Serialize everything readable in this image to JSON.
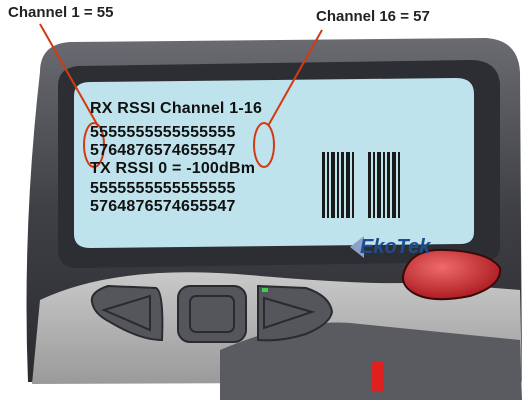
{
  "callouts": {
    "left": "Channel 1 = 55",
    "right": "Channel 16 = 57"
  },
  "lcd": {
    "lines": [
      "RX RSSI Channel 1-16",
      "5555555555555555",
      "5764876574655547",
      "TX RSSI 0 = -100dBm",
      "5555555555555555",
      "5764876574655547"
    ]
  },
  "logo": {
    "text": "EkoTek"
  },
  "colors": {
    "lcd_background": "#bfe3ec",
    "device_body": "#4a4b50",
    "callout_ellipse": "#d23a12",
    "action_button": "#c8262a",
    "indicator_led": "#e02020"
  },
  "icons": {
    "left_button": "triangle-left-icon",
    "center_button": "square-icon",
    "right_button": "triangle-right-icon"
  }
}
